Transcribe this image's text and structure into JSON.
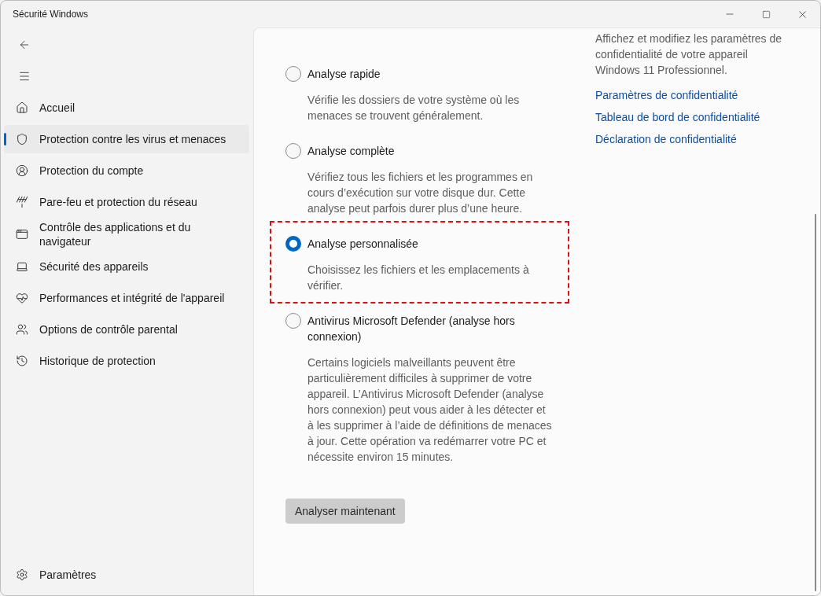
{
  "window": {
    "title": "Sécurité Windows"
  },
  "sidebar": {
    "items": [
      {
        "label": "Accueil",
        "selected": false
      },
      {
        "label": "Protection contre les virus et menaces",
        "selected": true
      },
      {
        "label": "Protection du compte",
        "selected": false
      },
      {
        "label": "Pare-feu et protection du réseau",
        "selected": false
      },
      {
        "label": "Contrôle des applications et du navigateur",
        "selected": false
      },
      {
        "label": "Sécurité des appareils",
        "selected": false
      },
      {
        "label": "Performances et intégrité de l'appareil",
        "selected": false
      },
      {
        "label": "Options de contrôle parental",
        "selected": false
      },
      {
        "label": "Historique de protection",
        "selected": false
      }
    ],
    "footer": {
      "label": "Paramètres"
    }
  },
  "scan_options": [
    {
      "title": "Analyse rapide",
      "description": "Vérifie les dossiers de votre système où les menaces se trouvent généralement.",
      "selected": false,
      "highlighted": false
    },
    {
      "title": "Analyse complète",
      "description": "Vérifiez tous les fichiers et les programmes en cours d’exécution sur votre disque dur. Cette analyse peut parfois durer plus d’une heure.",
      "selected": false,
      "highlighted": false
    },
    {
      "title": "Analyse personnalisée",
      "description": "Choisissez les fichiers et les emplacements à vérifier.",
      "selected": true,
      "highlighted": true
    },
    {
      "title": "Antivirus Microsoft Defender (analyse hors connexion)",
      "description": "Certains logiciels malveillants peuvent être particulièrement difficiles à supprimer de votre appareil. L’Antivirus Microsoft Defender (analyse hors connexion) peut vous aider à les détecter et à les supprimer à l’aide de définitions de menaces à jour. Cette opération va redémarrer votre PC et nécessite environ 15 minutes.",
      "selected": false,
      "highlighted": false
    }
  ],
  "scan_button": {
    "label": "Analyser maintenant",
    "disabled": true
  },
  "privacy": {
    "text": "Affichez et modifiez les paramètres de confidentialité de votre appareil Windows 11 Professionnel.",
    "links": [
      "Paramètres de confidentialité",
      "Tableau de bord de confidentialité",
      "Déclaration de confidentialité"
    ]
  }
}
